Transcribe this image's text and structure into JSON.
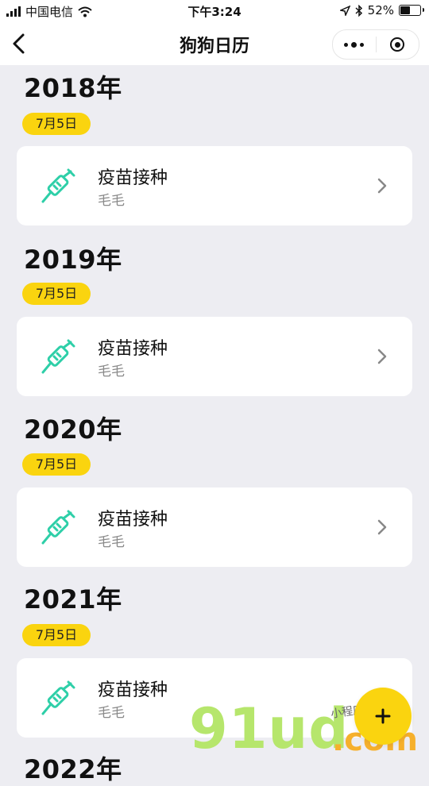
{
  "status_bar": {
    "carrier": "中国电信",
    "time": "下午3:24",
    "battery": "52%",
    "battery_level": 0.52
  },
  "nav": {
    "title": "狗狗日历",
    "back_icon": "chevron-left-icon",
    "more_icon": "more-dots-icon",
    "close_icon": "target-circle-icon"
  },
  "entries": [
    {
      "year": "2018年",
      "date": "7月5日",
      "title": "疫苗接种",
      "pet": "毛毛",
      "icon": "syringe-icon"
    },
    {
      "year": "2019年",
      "date": "7月5日",
      "title": "疫苗接种",
      "pet": "毛毛",
      "icon": "syringe-icon"
    },
    {
      "year": "2020年",
      "date": "7月5日",
      "title": "疫苗接种",
      "pet": "毛毛",
      "icon": "syringe-icon"
    },
    {
      "year": "2021年",
      "date": "7月5日",
      "title": "疫苗接种",
      "pet": "毛毛",
      "icon": "syringe-icon"
    },
    {
      "year": "2022年"
    }
  ],
  "fab": {
    "symbol": "+"
  },
  "watermark": {
    "main": "91ud",
    "suffix": ".com",
    "small": "小程序商店"
  },
  "colors": {
    "accent": "#fad40f",
    "syringe": "#2ecfa8",
    "background": "#ededf2"
  }
}
